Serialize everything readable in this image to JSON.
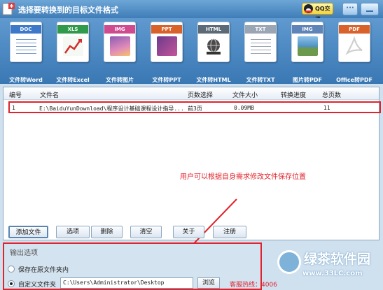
{
  "window": {
    "title": "选择要转换到的目标文件格式"
  },
  "header": {
    "qq_button": "QQ交谈"
  },
  "toolbar": {
    "items": [
      {
        "tag": "DOC",
        "label": "文件转Word",
        "tag_color": "#3d78c9",
        "icon": "word-document-icon"
      },
      {
        "tag": "XLS",
        "label": "文件转Excel",
        "tag_color": "#2f9a49",
        "icon": "excel-spreadsheet-icon"
      },
      {
        "tag": "IMG",
        "label": "文件转图片",
        "tag_color": "#d04a8f",
        "icon": "image-icon"
      },
      {
        "tag": "PPT",
        "label": "文件转PPT",
        "tag_color": "#d9622b",
        "icon": "powerpoint-icon"
      },
      {
        "tag": "HTML",
        "label": "文件转HTML",
        "tag_color": "#5c6a78",
        "icon": "html-globe-icon"
      },
      {
        "tag": "TXT",
        "label": "文件转TXT",
        "tag_color": "#9aa6b3",
        "icon": "text-file-icon"
      },
      {
        "tag": "IMG",
        "label": "图片转PDF",
        "tag_color": "#5f84b7",
        "icon": "image-to-pdf-icon"
      },
      {
        "tag": "PDF",
        "label": "Office转PDF",
        "tag_color": "#d9622b",
        "icon": "pdf-icon"
      }
    ]
  },
  "table": {
    "headers": [
      "编号",
      "文件名",
      "页数选择",
      "文件大小",
      "转换进度",
      "总页数"
    ],
    "rows": [
      {
        "num": "1",
        "file": "E:\\BaiduYunDownload\\程序设计基础课程设计指导...",
        "pages": "前3页",
        "size": "0.09MB",
        "progress": "",
        "total": "11"
      }
    ]
  },
  "annotation": "用户可以根据自身需求修改文件保存位置",
  "buttons": {
    "add": "添加文件",
    "options": "选项",
    "delete": "删除",
    "clear": "清空",
    "about": "关于",
    "register": "注册"
  },
  "output": {
    "title": "输出选项",
    "option_same": "保存在原文件夹内",
    "option_custom": "自定义文件夹",
    "path": "C:\\Users\\Administrator\\Desktop",
    "browse": "浏览",
    "hotline": "客服热线：4006"
  },
  "watermark": {
    "text": "绿茶软件园",
    "url": "www.33LC.com"
  }
}
